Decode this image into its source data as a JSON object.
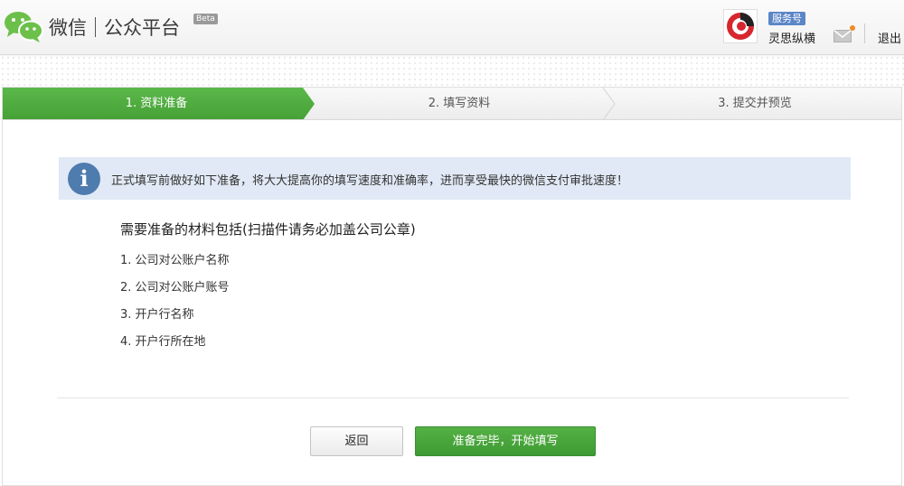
{
  "header": {
    "brand": "微信",
    "product": "公众平台",
    "beta": "Beta",
    "account_type": "服务号",
    "account_name": "灵思纵横",
    "logout": "退出"
  },
  "steps": [
    {
      "label": "1. 资料准备",
      "active": true
    },
    {
      "label": "2. 填写资料",
      "active": false
    },
    {
      "label": "3. 提交并预览",
      "active": false
    }
  ],
  "notice": {
    "icon": "info-icon",
    "text": "正式填写前做好如下准备，将大大提高你的填写速度和准确率，进而享受最快的微信支付审批速度！"
  },
  "requirements": {
    "heading": "需要准备的材料包括(扫描件请务必加盖公司公章)",
    "items": [
      "1. 公司对公账户名称",
      "2. 公司对公账户账号",
      "3. 开户行名称",
      "4. 开户行所在地"
    ]
  },
  "buttons": {
    "back": "返回",
    "start": "准备完毕，开始填写"
  },
  "colors": {
    "accent_green": "#4caf3e",
    "notice_bg": "#e0e9f5",
    "badge_blue": "#5b86c7",
    "mail_dot": "#f08a24"
  }
}
